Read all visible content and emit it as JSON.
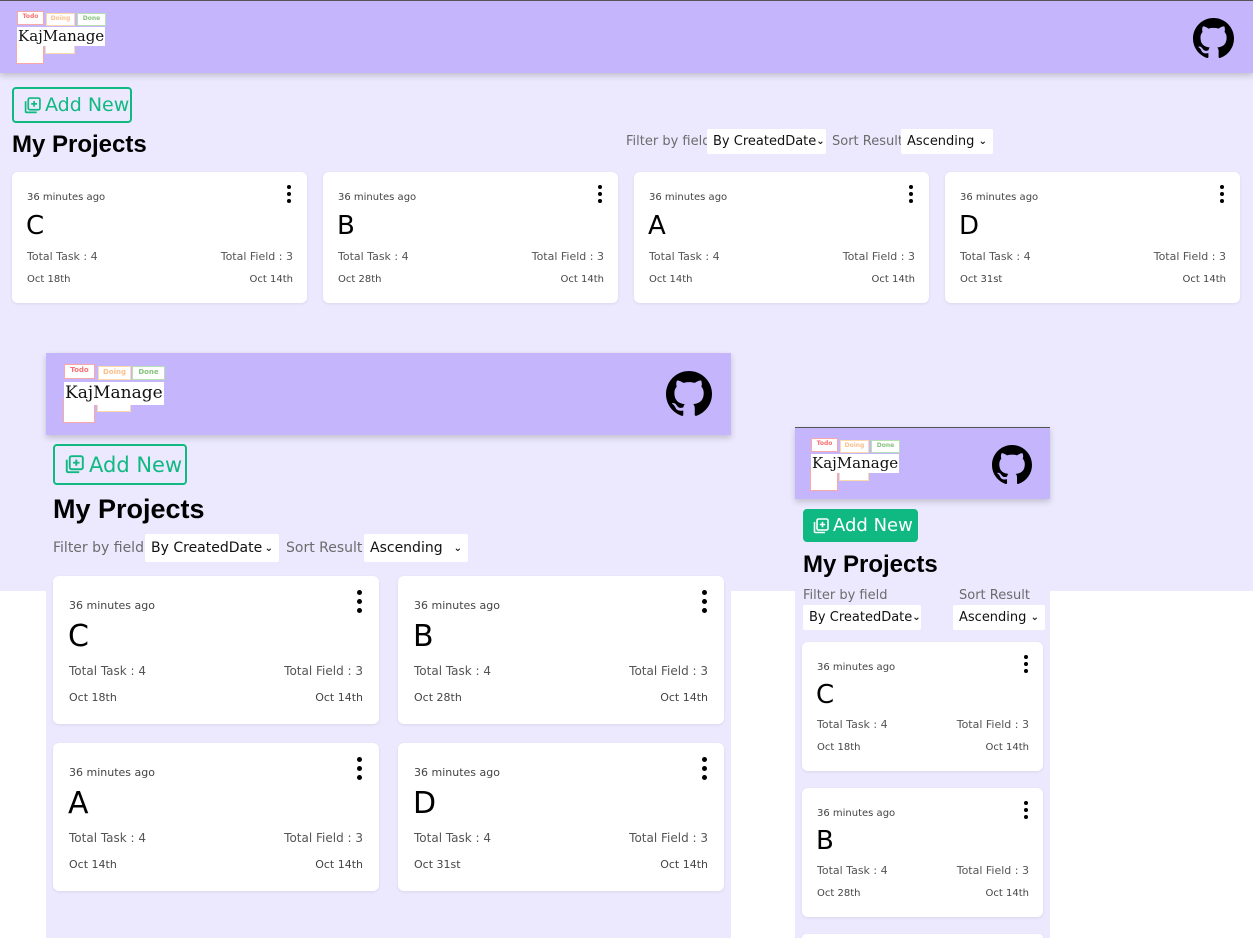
{
  "logo": {
    "todo": "Todo",
    "doing": "Doing",
    "done": "Done",
    "name": "KajManage"
  },
  "icons": {
    "github": "github-icon",
    "add": "add-square-icon",
    "more": "more-vertical-icon",
    "chevron": "chevron-down-icon"
  },
  "toolbar": {
    "add_label": "Add New",
    "title": "My Projects",
    "filter_label": "Filter by field",
    "filter_value": "By CreatedDate",
    "sort_label": "Sort Result",
    "sort_value": "Ascending"
  },
  "projects": [
    {
      "time": "36 minutes ago",
      "name": "C",
      "total_task": "Total Task : 4",
      "total_field": "Total Field : 3",
      "due": "Oct 18th",
      "created": "Oct 14th"
    },
    {
      "time": "36 minutes ago",
      "name": "B",
      "total_task": "Total Task : 4",
      "total_field": "Total Field : 3",
      "due": "Oct 28th",
      "created": "Oct 14th"
    },
    {
      "time": "36 minutes ago",
      "name": "A",
      "total_task": "Total Task : 4",
      "total_field": "Total Field : 3",
      "due": "Oct 14th",
      "created": "Oct 14th"
    },
    {
      "time": "36 minutes ago",
      "name": "D",
      "total_task": "Total Task : 4",
      "total_field": "Total Field : 3",
      "due": "Oct 31st",
      "created": "Oct 14th"
    }
  ],
  "colors": {
    "header": "#c4b5fd",
    "page_bg": "#ece9fe",
    "accent": "#10b981"
  }
}
